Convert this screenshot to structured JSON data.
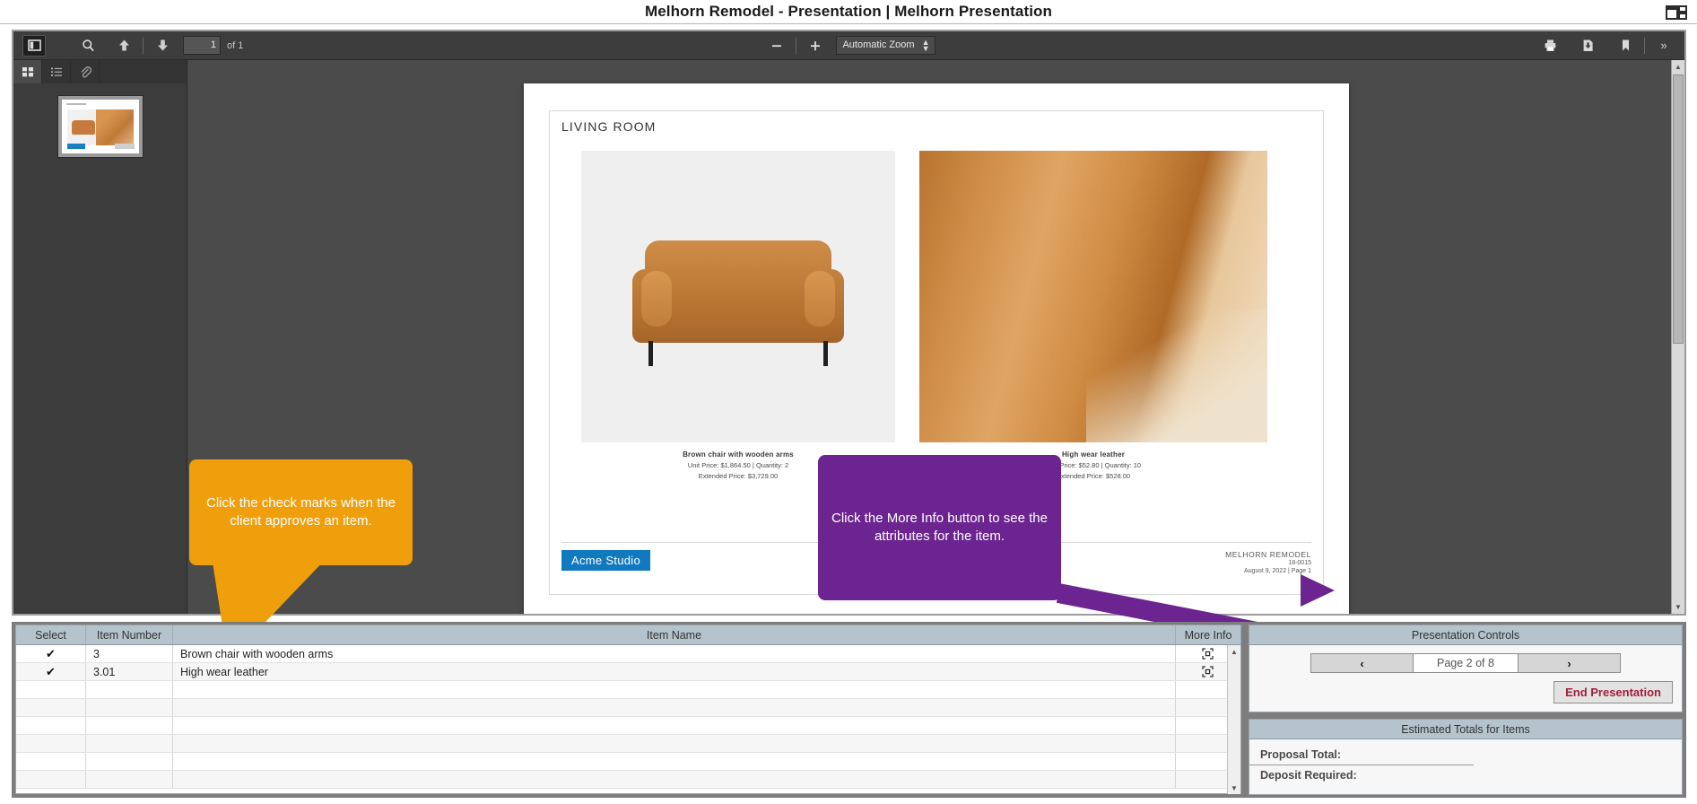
{
  "window": {
    "title": "Melhorn Remodel - Presentation | Melhorn Presentation",
    "window_icon": "restore-window-icon"
  },
  "pdf_toolbar": {
    "sidebar_toggle": "sidebar-toggle-icon",
    "search": "search-icon",
    "prev_page": "up-arrow-icon",
    "next_page": "down-arrow-icon",
    "page_number": "1",
    "page_of": "of 1",
    "zoom_out": "minus-icon",
    "zoom_in": "plus-icon",
    "zoom_level": "Automatic Zoom",
    "print": "print-icon",
    "download": "download-icon",
    "bookmark": "bookmark-icon",
    "more_tools": "»"
  },
  "pdf_sidebar": {
    "tabs": [
      {
        "name": "thumbnails-tab",
        "icon": "thumbnails-icon"
      },
      {
        "name": "outline-tab",
        "icon": "list-icon"
      },
      {
        "name": "attachments-tab",
        "icon": "paperclip-icon"
      }
    ]
  },
  "document": {
    "room_title": "LIVING ROOM",
    "items": [
      {
        "name": "Brown chair with wooden arms",
        "price_line": "Unit Price: $1,864.50  |  Quantity: 2",
        "extended_line": "Extended Price: $3,729.00"
      },
      {
        "name": "High wear leather",
        "price_line": "Unit Price: $52.80  |  Quantity: 10",
        "extended_line": "Extended Price: $528.00"
      }
    ],
    "footer": {
      "logo": "Acme Studio",
      "project": "MELHORN REMODEL",
      "project_number": "18-0015",
      "date_page": "August 9, 2022  |  Page 1"
    }
  },
  "callouts": {
    "orange": {
      "text": "Click the check marks when the client approves an item.",
      "color": "#ef9f0c"
    },
    "purple": {
      "text": "Click the More Info button to see the attributes for the item.",
      "color": "#6c2490"
    }
  },
  "grid": {
    "columns": [
      "Select",
      "Item Number",
      "Item Name",
      "More Info"
    ],
    "rows": [
      {
        "select": "✔",
        "number": "3",
        "name": "Brown chair with wooden arms",
        "more": "more-info-icon"
      },
      {
        "select": "✔",
        "number": "3.01",
        "name": "High wear leather",
        "more": "more-info-icon"
      }
    ]
  },
  "presentation_controls": {
    "title": "Presentation Controls",
    "prev_label": "‹",
    "page_label": "Page 2 of 8",
    "next_label": "›",
    "end_label": "End Presentation",
    "end_color": "#a31e3a"
  },
  "totals": {
    "title": "Estimated Totals for  Items",
    "rows": [
      {
        "label": "Proposal Total:",
        "value": ""
      },
      {
        "label": "Deposit Required:",
        "value": ""
      }
    ]
  }
}
